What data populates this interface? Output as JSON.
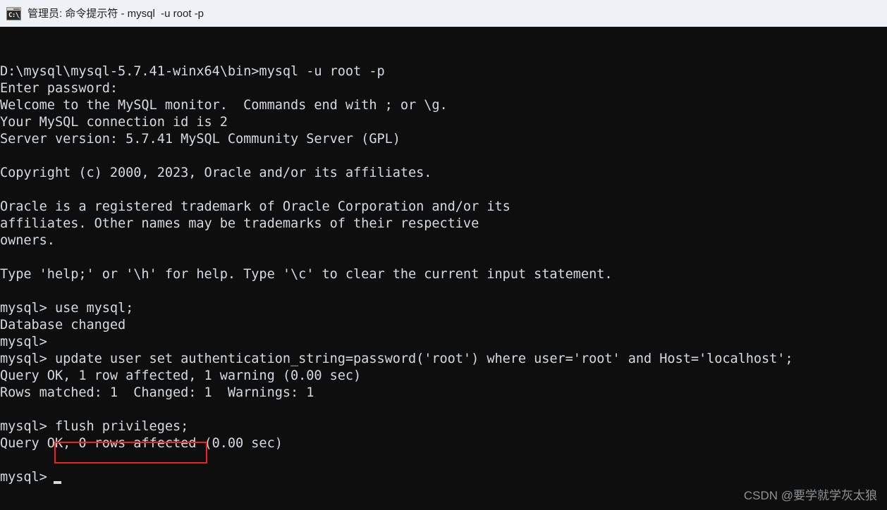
{
  "window": {
    "title": "管理员: 命令提示符 - mysql  -u root -p",
    "icon_name": "console-icon",
    "icon_glyph": "C:\\_",
    "titlebar_color": "#eef2f6",
    "terminal_bg": "#0e0e0e",
    "terminal_fg": "#d6dadf"
  },
  "terminal": {
    "lines": [
      "D:\\mysql\\mysql-5.7.41-winx64\\bin>mysql -u root -p",
      "Enter password:",
      "Welcome to the MySQL monitor.  Commands end with ; or \\g.",
      "Your MySQL connection id is 2",
      "Server version: 5.7.41 MySQL Community Server (GPL)",
      "",
      "Copyright (c) 2000, 2023, Oracle and/or its affiliates.",
      "",
      "Oracle is a registered trademark of Oracle Corporation and/or its",
      "affiliates. Other names may be trademarks of their respective",
      "owners.",
      "",
      "Type 'help;' or '\\h' for help. Type '\\c' to clear the current input statement.",
      "",
      "mysql> use mysql;",
      "Database changed",
      "mysql>",
      "mysql> update user set authentication_string=password('root') where user='root' and Host='localhost';",
      "Query OK, 1 row affected, 1 warning (0.00 sec)",
      "Rows matched: 1  Changed: 1  Warnings: 1",
      "",
      "mysql> flush privileges;",
      "Query OK, 0 rows affected (0.00 sec)",
      "",
      "mysql>"
    ],
    "prompt_cursor": "_"
  },
  "annotation": {
    "highlight_color": "#ee2222",
    "highlighted_command": "flush privileges;"
  },
  "watermark": {
    "text": "CSDN @要学就学灰太狼"
  }
}
